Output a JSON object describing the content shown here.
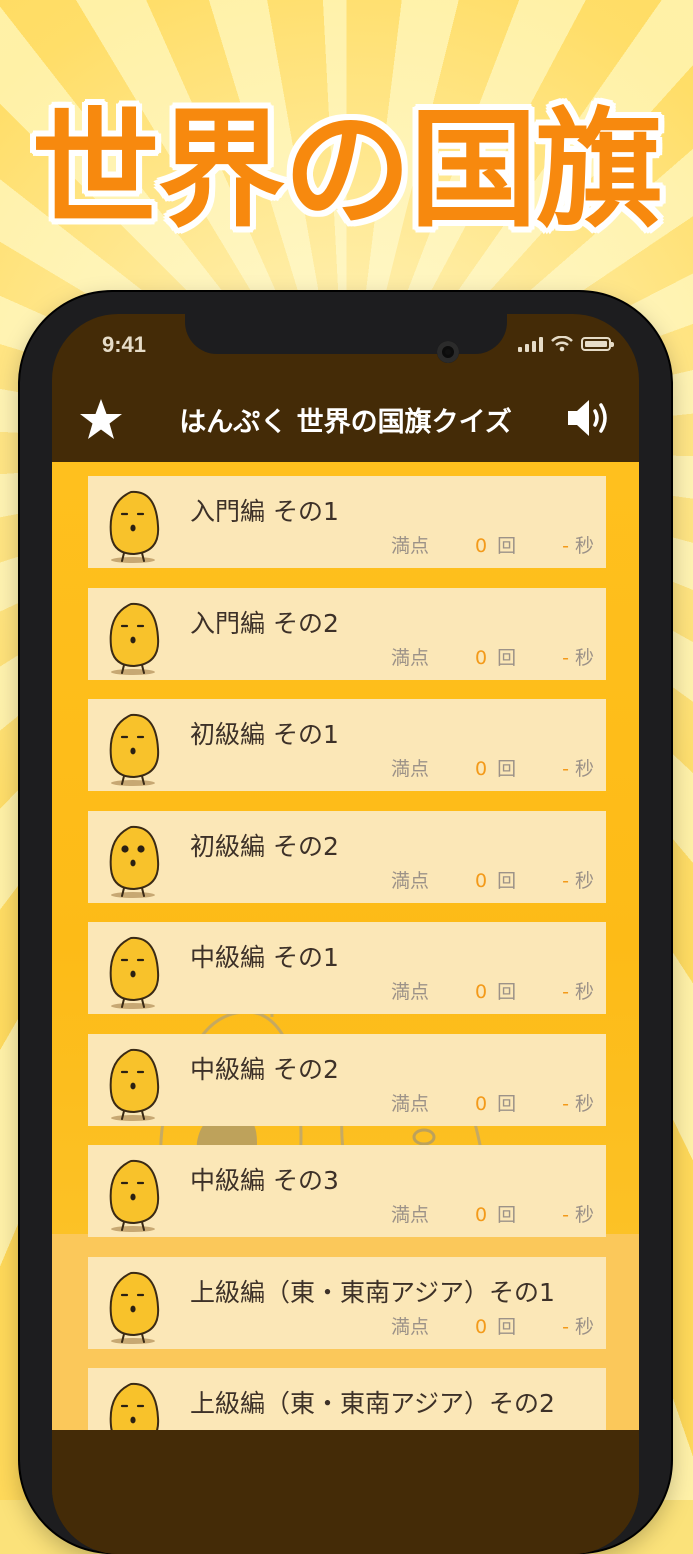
{
  "hero": {
    "title": "世界の国旗"
  },
  "status": {
    "time": "9:41"
  },
  "nav": {
    "title": "はんぷく 世界の国旗クイズ"
  },
  "colors": {
    "accent": "#f7890e",
    "header": "#442b07",
    "list_bg": "#fdbb17",
    "item_bg": "#fbe7b7"
  },
  "icons": {
    "left": "star-icon",
    "right": "speaker-icon",
    "item": "potato-mascot-icon"
  },
  "items": [
    {
      "label": "入門編 その1",
      "score_prefix": "満点",
      "count": "0",
      "count_unit": "回",
      "time": "-",
      "time_unit": "秒"
    },
    {
      "label": "入門編 その2",
      "score_prefix": "満点",
      "count": "0",
      "count_unit": "回",
      "time": "-",
      "time_unit": "秒"
    },
    {
      "label": "初級編 その1",
      "score_prefix": "満点",
      "count": "0",
      "count_unit": "回",
      "time": "-",
      "time_unit": "秒"
    },
    {
      "label": "初級編 その2",
      "score_prefix": "満点",
      "count": "0",
      "count_unit": "回",
      "time": "-",
      "time_unit": "秒"
    },
    {
      "label": "中級編 その1",
      "score_prefix": "満点",
      "count": "0",
      "count_unit": "回",
      "time": "-",
      "time_unit": "秒"
    },
    {
      "label": "中級編 その2",
      "score_prefix": "満点",
      "count": "0",
      "count_unit": "回",
      "time": "-",
      "time_unit": "秒"
    },
    {
      "label": "中級編 その3",
      "score_prefix": "満点",
      "count": "0",
      "count_unit": "回",
      "time": "-",
      "time_unit": "秒"
    },
    {
      "label": "上級編（東・東南アジア）その1",
      "score_prefix": "満点",
      "count": "0",
      "count_unit": "回",
      "time": "-",
      "time_unit": "秒"
    },
    {
      "label": "上級編（東・東南アジア）その2"
    }
  ]
}
